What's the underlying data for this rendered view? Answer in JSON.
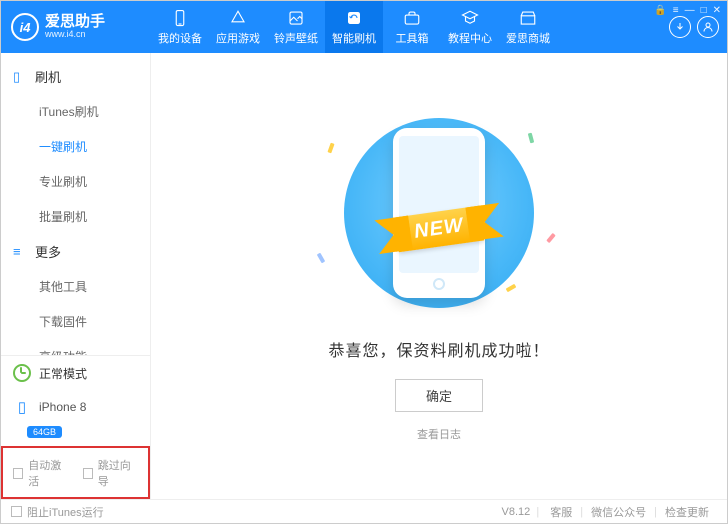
{
  "brand": {
    "title": "爱思助手",
    "subtitle": "www.i4.cn"
  },
  "nav": {
    "items": [
      {
        "label": "我的设备"
      },
      {
        "label": "应用游戏"
      },
      {
        "label": "铃声壁纸"
      },
      {
        "label": "智能刷机"
      },
      {
        "label": "工具箱"
      },
      {
        "label": "教程中心"
      },
      {
        "label": "爱思商城"
      }
    ],
    "active_index": 3
  },
  "sidebar": {
    "group_flash": {
      "title": "刷机",
      "items": [
        "iTunes刷机",
        "一键刷机",
        "专业刷机",
        "批量刷机"
      ],
      "active_index": 1
    },
    "group_more": {
      "title": "更多",
      "items": [
        "其他工具",
        "下载固件",
        "高级功能"
      ]
    },
    "mode_label": "正常模式",
    "device": {
      "name": "iPhone 8",
      "capacity": "64GB"
    },
    "checkboxes": {
      "auto_activate": "自动激活",
      "skip_guide": "跳过向导"
    }
  },
  "main": {
    "ribbon": "NEW",
    "success_text": "恭喜您，保资料刷机成功啦！",
    "ok_button": "确定",
    "view_log": "查看日志"
  },
  "footer": {
    "block_itunes": "阻止iTunes运行",
    "version": "V8.12",
    "links": [
      "客服",
      "微信公众号",
      "检查更新"
    ]
  },
  "colors": {
    "primary": "#1e8cff"
  }
}
